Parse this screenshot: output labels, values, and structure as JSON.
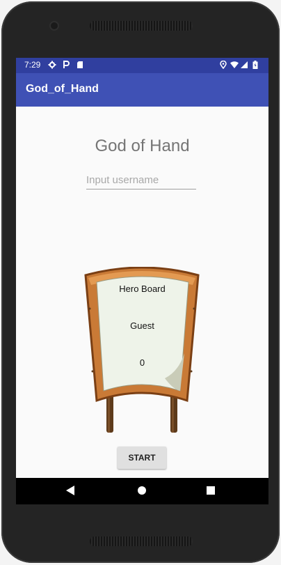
{
  "device": {
    "status_time": "7:29"
  },
  "app": {
    "title": "God_of_Hand"
  },
  "main": {
    "game_title": "God of Hand",
    "username_placeholder": "Input username",
    "board": {
      "heading": "Hero Board",
      "player": "Guest",
      "score": "0"
    },
    "start_label": "START"
  },
  "icons": {
    "status_left": [
      "gear-icon",
      "parking-icon",
      "sd-card-icon"
    ],
    "status_right": [
      "location-icon",
      "wifi-icon",
      "signal-icon",
      "battery-icon"
    ],
    "nav": [
      "back-icon",
      "home-icon",
      "recents-icon"
    ]
  },
  "colors": {
    "status_bar": "#303f9f",
    "app_bar": "#3f51b5",
    "button_bg": "#e0e0e0"
  }
}
